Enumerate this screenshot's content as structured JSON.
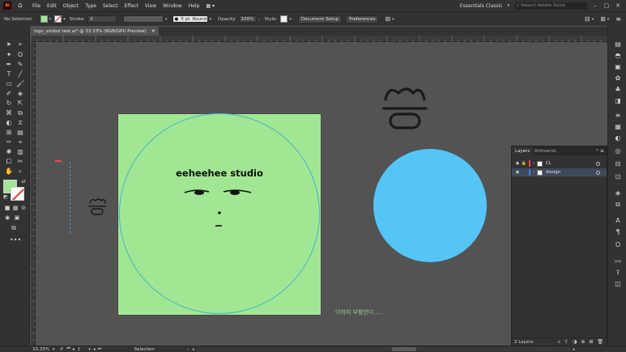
{
  "menubar": {
    "logo": "Ai",
    "items": [
      "File",
      "Edit",
      "Object",
      "Type",
      "Select",
      "Effect",
      "View",
      "Window",
      "Help"
    ],
    "workspace": "Essentials Classic",
    "search_placeholder": "Search Adobe Stock"
  },
  "control": {
    "selection": "No Selection",
    "stroke_label": "Stroke:",
    "brush": "5 pt. Round",
    "opacity_label": "Opacity:",
    "opacity": "100%",
    "style_label": "Style:",
    "doc_setup": "Document Setup",
    "preferences": "Preferences"
  },
  "document": {
    "tab_title": "logo_simbol test.ai* @ 33.33% (RGB/GPU Preview)"
  },
  "artwork": {
    "studio_text": "eeheehee studio",
    "korean_note": "이하히 부활한다.....",
    "artboard_color": "#a1e793",
    "circle_color": "#55c5f5",
    "guide_color": "#3fb3ce",
    "korean_color": "#8fd27d"
  },
  "layers": {
    "tab_layers": "Layers",
    "tab_artboards": "Artboards",
    "rows": [
      {
        "name": "CL",
        "color": "#e84b4b"
      },
      {
        "name": "design",
        "color": "#4b7be8"
      }
    ],
    "count": "2 Layers"
  },
  "status": {
    "zoom": "33.33%",
    "page": "1",
    "tool": "Selection"
  }
}
